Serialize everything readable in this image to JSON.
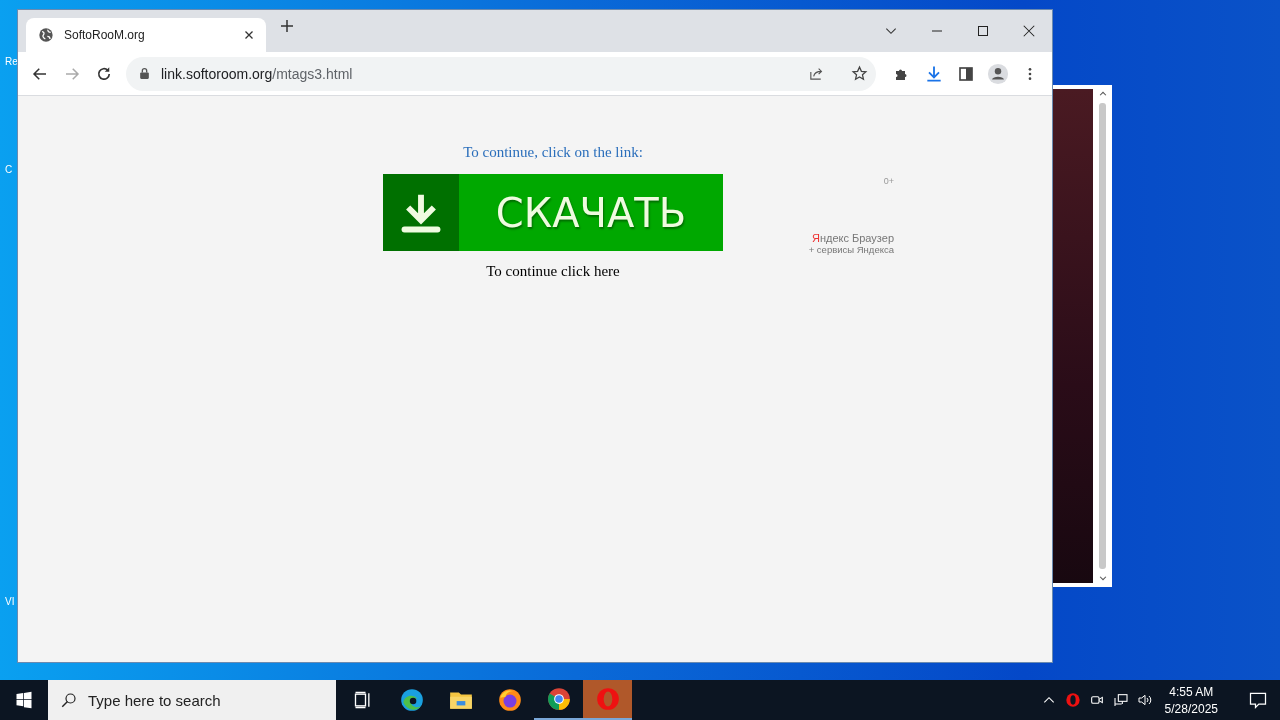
{
  "desktop": {
    "icon_labels": [
      "Re",
      "C",
      "VI"
    ]
  },
  "browser": {
    "tabs": [
      {
        "title": "SoftoRooM.org",
        "selected": true
      }
    ],
    "address": {
      "host": "link.softoroom.org",
      "path": "/mtags3.html"
    },
    "page": {
      "prompt": "To continue, click on the link:",
      "download_button": "СКАЧАТЬ",
      "continue_link": "To continue click here",
      "ad": {
        "age_rating": "0+",
        "title": "Яндекс Браузер",
        "subtitle": "+ сервисы Яндекса"
      }
    }
  },
  "taskbar": {
    "search_placeholder": "Type here to search",
    "apps": [
      {
        "kind": "task-view",
        "running": false,
        "active": false
      },
      {
        "kind": "edge",
        "running": false,
        "active": false
      },
      {
        "kind": "explorer",
        "running": false,
        "active": false
      },
      {
        "kind": "firefox",
        "running": false,
        "active": false
      },
      {
        "kind": "chrome",
        "running": true,
        "active": false
      },
      {
        "kind": "opera",
        "running": true,
        "active": true
      }
    ],
    "clock": {
      "time": "4:55 AM",
      "date": "5/28/2025"
    }
  }
}
